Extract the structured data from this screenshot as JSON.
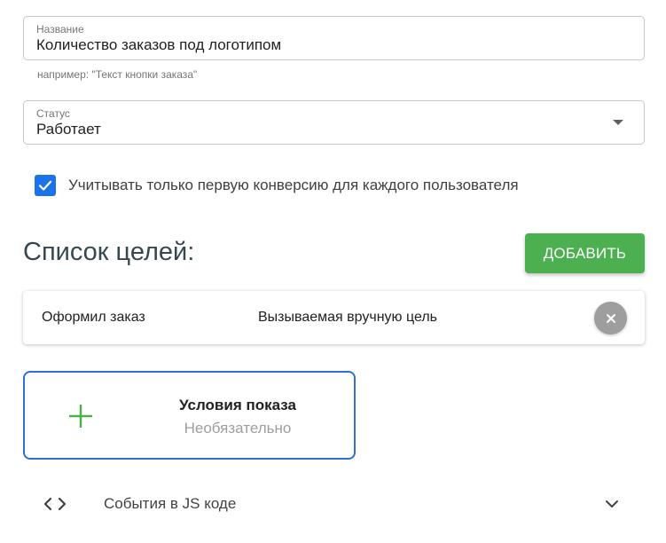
{
  "name_field": {
    "label": "Название",
    "value": "Количество заказов под логотипом",
    "hint": "например: \"Текст кнопки заказа\""
  },
  "status_field": {
    "label": "Статус",
    "value": "Работает"
  },
  "checkbox": {
    "label": "Учитывать только первую конверсию для каждого пользователя",
    "checked": true
  },
  "goals": {
    "title": "Список целей:",
    "add_label": "ДОБАВИТЬ",
    "items": [
      {
        "name": "Оформил заказ",
        "type": "Вызываемая вручную цель"
      }
    ]
  },
  "conditions": {
    "title": "Условия показа",
    "subtitle": "Необязательно"
  },
  "events": {
    "label": "События в JS коде"
  },
  "colors": {
    "accent_blue": "#1a73e8",
    "add_green": "#4caf50",
    "plus_green": "#4caf50",
    "card_border_blue": "#2f6fd1"
  }
}
